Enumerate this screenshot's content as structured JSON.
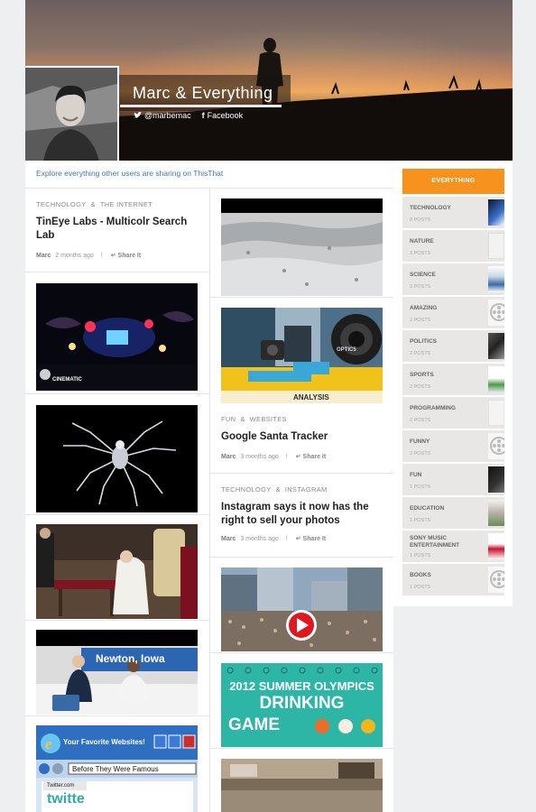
{
  "profile": {
    "name": "Marc  &  Everything",
    "twitter": "@marbemac",
    "facebook": "Facebook",
    "twitter_icon": "twitter-bird-icon",
    "facebook_icon": "facebook-f-icon"
  },
  "explore_text": "Explore everything other users are sharing on ThisThat",
  "left_column": {
    "post1": {
      "cat1": "TECHNOLOGY",
      "amp": "&",
      "cat2": "THE INTERNET",
      "title": "TinEye Labs - Multicolr Search Lab",
      "author": "Marc",
      "time": "2 months ago",
      "fb": "f",
      "share": "Share It"
    },
    "img1_badge": "CINEMATIC",
    "img_window_title": "Your Favorite Websites!",
    "img_window_address": "Before They Were Famous",
    "img_window_tab": "Twitter.com",
    "img_window_logo": "twitte",
    "img_newton": "Newton, Iowa"
  },
  "mid_column": {
    "post1": {
      "cat1": "FUN",
      "amp": "&",
      "cat2": "WEBSITES",
      "title": "Google Santa Tracker",
      "author": "Marc",
      "time": "3 months ago",
      "fb": "f",
      "share": "Share It"
    },
    "post2": {
      "cat1": "TECHNOLOGY",
      "amp": "&",
      "cat2": "INSTAGRAM",
      "title": "Instagram says it now has the right to sell your photos",
      "author": "Marc",
      "time": "3 months ago",
      "fb": "f",
      "share": "Share It"
    },
    "img_analysis": "ANALYSIS",
    "img_optics": "OPTIC5",
    "img_olympics": "2012 SUMMER OLYMPICS",
    "img_drinking": "DRINKING",
    "img_game": "GAME"
  },
  "sidebar": {
    "header": "EVERYTHING",
    "items": [
      {
        "name": "TECHNOLOGY",
        "count": "8 POSTS"
      },
      {
        "name": "NATURE",
        "count": "3 POSTS"
      },
      {
        "name": "SCIENCE",
        "count": "3 POSTS"
      },
      {
        "name": "AMAZING",
        "count": "2 POSTS"
      },
      {
        "name": "POLITICS",
        "count": "2 POSTS"
      },
      {
        "name": "SPORTS",
        "count": "2 POSTS"
      },
      {
        "name": "PROGRAMMING",
        "count": "2 POSTS"
      },
      {
        "name": "FUNNY",
        "count": "2 POSTS"
      },
      {
        "name": "FUN",
        "count": "1 POSTS"
      },
      {
        "name": "EDUCATION",
        "count": "1 POSTS"
      },
      {
        "name": "SONY MUSIC ENTERTAINMENT",
        "count": "1 POSTS"
      },
      {
        "name": "BOOKS",
        "count": "1 POSTS"
      }
    ]
  },
  "colors": {
    "accent": "#f7921e",
    "link": "#3b78b8",
    "background": "#edeff1"
  }
}
